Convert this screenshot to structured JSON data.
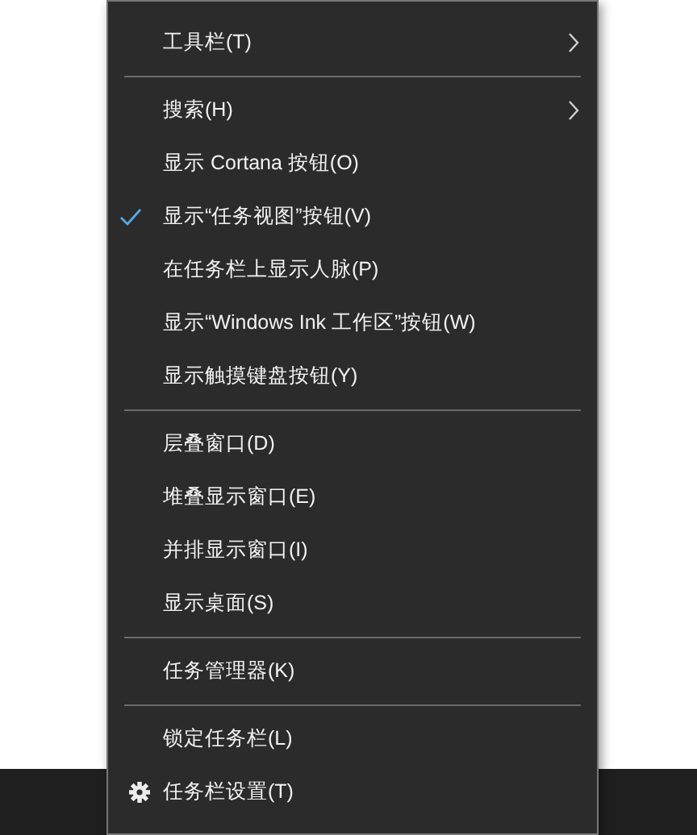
{
  "context_menu": {
    "items": [
      {
        "kind": "item",
        "label": "工具栏(T)",
        "checked": false,
        "submenu": true
      },
      {
        "kind": "separator"
      },
      {
        "kind": "item",
        "label": "搜索(H)",
        "checked": false,
        "submenu": true
      },
      {
        "kind": "item",
        "label": "显示 Cortana 按钮(O)",
        "checked": false,
        "submenu": false
      },
      {
        "kind": "item",
        "label": "显示“任务视图”按钮(V)",
        "checked": true,
        "submenu": false
      },
      {
        "kind": "item",
        "label": "在任务栏上显示人脉(P)",
        "checked": false,
        "submenu": false
      },
      {
        "kind": "item",
        "label": "显示“Windows Ink 工作区”按钮(W)",
        "checked": false,
        "submenu": false
      },
      {
        "kind": "item",
        "label": "显示触摸键盘按钮(Y)",
        "checked": false,
        "submenu": false
      },
      {
        "kind": "separator"
      },
      {
        "kind": "item",
        "label": "层叠窗口(D)",
        "checked": false,
        "submenu": false
      },
      {
        "kind": "item",
        "label": "堆叠显示窗口(E)",
        "checked": false,
        "submenu": false
      },
      {
        "kind": "item",
        "label": "并排显示窗口(I)",
        "checked": false,
        "submenu": false
      },
      {
        "kind": "item",
        "label": "显示桌面(S)",
        "checked": false,
        "submenu": false
      },
      {
        "kind": "separator"
      },
      {
        "kind": "item",
        "label": "任务管理器(K)",
        "checked": false,
        "submenu": false
      },
      {
        "kind": "separator"
      },
      {
        "kind": "item",
        "label": "锁定任务栏(L)",
        "checked": false,
        "submenu": false
      },
      {
        "kind": "settings",
        "label": "任务栏设置(T)",
        "checked": false,
        "submenu": false
      }
    ]
  }
}
